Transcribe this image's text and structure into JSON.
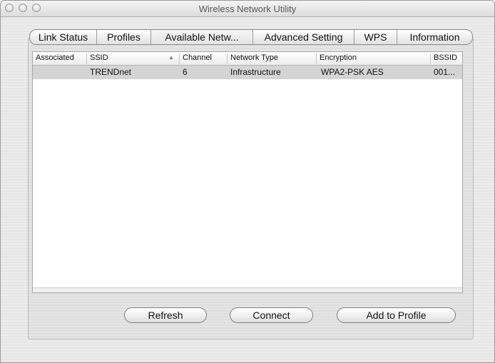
{
  "window": {
    "title": "Wireless Network Utility"
  },
  "tabs": [
    {
      "label": "Link Status"
    },
    {
      "label": "Profiles"
    },
    {
      "label": "Available Netw..."
    },
    {
      "label": "Advanced Setting"
    },
    {
      "label": "WPS"
    },
    {
      "label": "Information"
    }
  ],
  "table": {
    "columns": [
      "Associated",
      "SSID",
      "Channel",
      "Network Type",
      "Encryption",
      "BSSID"
    ],
    "sort_indicator": "▲",
    "rows": [
      {
        "associated": "",
        "ssid": "TRENDnet",
        "channel": "6",
        "network_type": "Infrastructure",
        "encryption": "WPA2-PSK AES",
        "bssid": "001..."
      }
    ]
  },
  "buttons": {
    "refresh": "Refresh",
    "connect": "Connect",
    "add_to_profile": "Add to Profile"
  }
}
